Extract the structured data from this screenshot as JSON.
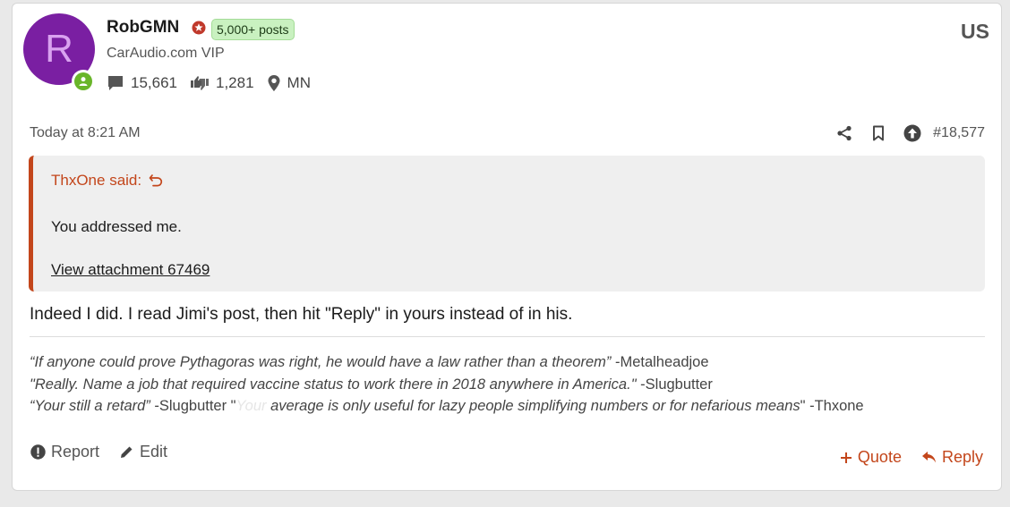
{
  "user": {
    "avatar_letter": "R",
    "name": "RobGMN",
    "badge": "5,000+ posts",
    "title": "CarAudio.com VIP",
    "messages": "15,661",
    "reactions": "1,281",
    "location": "MN",
    "country": "US"
  },
  "post": {
    "date": "Today at 8:21 AM",
    "number": "#18,577",
    "quote": {
      "author_said": "ThxOne said:",
      "text": "You addressed me.",
      "attachment": "View attachment 67469"
    },
    "body": "Indeed I did. I read Jimi's post, then hit \"Reply\" in yours instead of in his.",
    "signature": {
      "line1_quote": "“If anyone could prove Pythagoras was right, he would have a law rather than a theorem”",
      "line1_author": " -Metalheadjoe",
      "line2_quote": "\"Really. Name a job that required vaccine status to work there in 2018 anywhere in America.\"",
      "line2_author": " -Slugbutter",
      "line3_quote": "“Your still a retard”",
      "line3_mid": " -Slugbutter \"",
      "line3_ghost": "Your",
      "line3_quote2": " average is only useful for lazy people simplifying numbers or for nefarious means",
      "line3_end": "\" -Thxone"
    }
  },
  "footer": {
    "report": "Report",
    "edit": "Edit",
    "quote": "Quote",
    "reply": "Reply"
  },
  "colors": {
    "accent": "#c3461b",
    "avatar_bg": "#7a1fa2",
    "online": "#69b52a",
    "badge_bg": "#c9f1c0"
  },
  "icons": [
    "online-user-icon",
    "star-badge-icon",
    "messages-icon",
    "reactions-icon",
    "location-icon",
    "share-icon",
    "bookmark-icon",
    "upvote-icon",
    "quote-jump-icon",
    "report-icon",
    "edit-icon",
    "plus-icon",
    "reply-icon"
  ]
}
